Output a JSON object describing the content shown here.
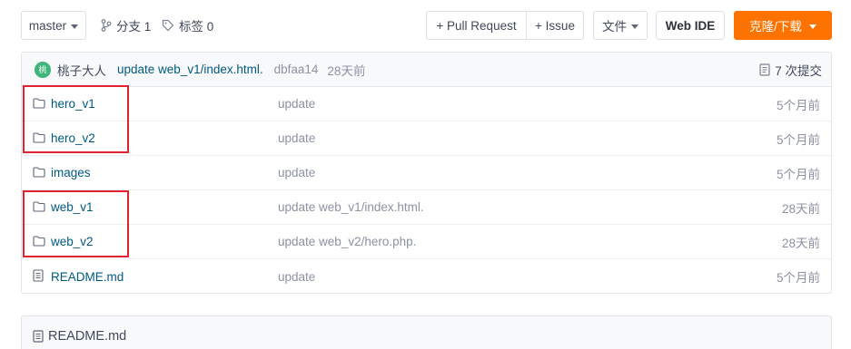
{
  "toolbar": {
    "branch": "master",
    "branches_label": "分支 1",
    "tags_label": "标签 0",
    "pull_request": "+ Pull Request",
    "issue": "+ Issue",
    "file_menu": "文件",
    "web_ide": "Web IDE",
    "clone": "克隆/下载"
  },
  "commit": {
    "avatar_text": "桃",
    "author": "桃子大人",
    "message": "update web_v1/index.html.",
    "hash": "dbfaa14",
    "time": "28天前",
    "count": "7 次提交"
  },
  "files": [
    {
      "name": "hero_v1",
      "type": "folder",
      "message": "update",
      "time": "5个月前"
    },
    {
      "name": "hero_v2",
      "type": "folder",
      "message": "update",
      "time": "5个月前"
    },
    {
      "name": "images",
      "type": "folder",
      "message": "update",
      "time": "5个月前"
    },
    {
      "name": "web_v1",
      "type": "folder",
      "message": "update web_v1/index.html.",
      "time": "28天前"
    },
    {
      "name": "web_v2",
      "type": "folder",
      "message": "update web_v2/hero.php.",
      "time": "28天前"
    },
    {
      "name": "README.md",
      "type": "file",
      "message": "update",
      "time": "5个月前"
    }
  ],
  "readme": {
    "title": "README.md"
  },
  "colors": {
    "accent_orange": "#fe7300",
    "link_blue": "#005980",
    "annotation_red": "#e0232e",
    "avatar_green": "#3fb57a"
  }
}
